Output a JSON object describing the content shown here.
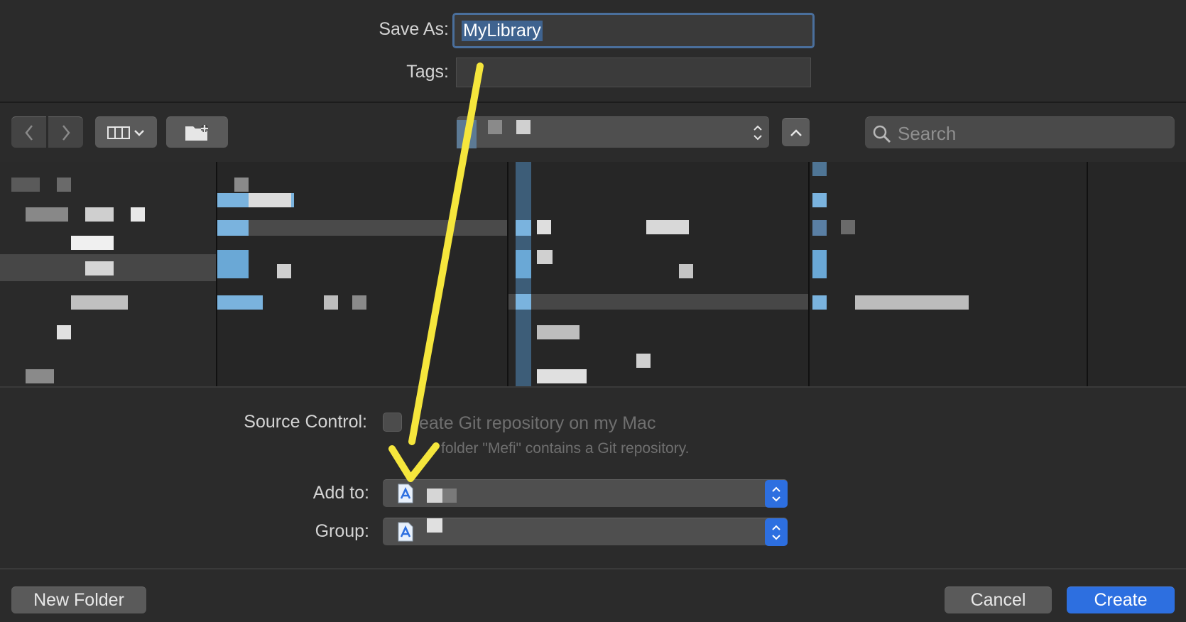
{
  "save_as": {
    "label": "Save As:",
    "value": "MyLibrary"
  },
  "tags": {
    "label": "Tags:",
    "value": ""
  },
  "toolbar": {
    "back_icon": "chevron-left-icon",
    "forward_icon": "chevron-right-icon",
    "view_icon": "column-view-icon",
    "new_folder_icon": "folder-plus-icon",
    "collapse_icon": "chevron-up-icon",
    "search_placeholder": "Search"
  },
  "source_control": {
    "label": "Source Control:",
    "checkbox_text": "eate Git repository on my Mac",
    "note": "folder \"Mefi\" contains a Git repository.",
    "checked": false
  },
  "add_to": {
    "label": "Add to:",
    "icon": "xcode-project-icon"
  },
  "group": {
    "label": "Group:",
    "icon": "xcode-project-icon"
  },
  "footer": {
    "new_folder": "New Folder",
    "cancel": "Cancel",
    "create": "Create"
  },
  "colors": {
    "accent": "#2d6fe0",
    "annotation_arrow": "#f5e63c",
    "text_selection": "#3f638f"
  }
}
